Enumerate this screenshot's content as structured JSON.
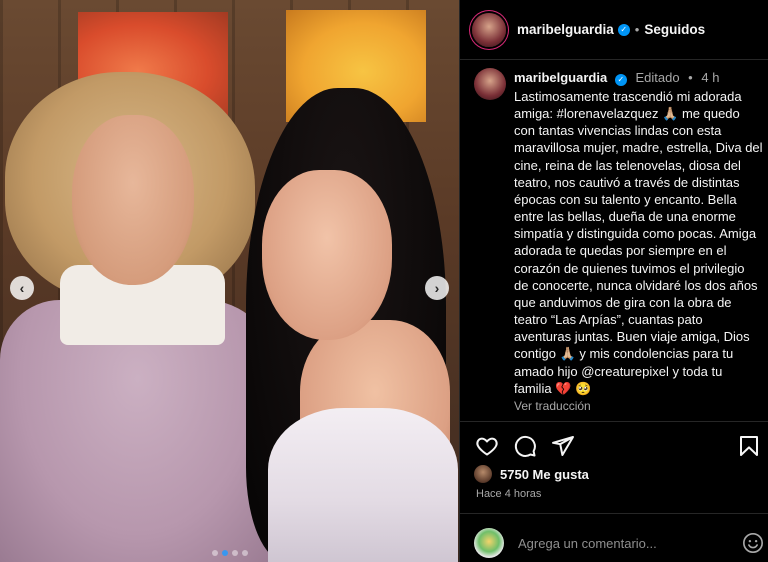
{
  "post": {
    "username": "maribelguardia",
    "following_label": "Seguidos",
    "separator": "•",
    "caption": {
      "edited_label": "Editado",
      "time_ago": "4 h",
      "text": "Lastimosamente trascendió mi adorada\namiga: #lorenavelazquez 🙏🏼 me quedo\ncon tantas vivencias lindas con esta\nmaravillosa mujer, madre, estrella, Diva del\ncine, reina de las telenovelas, diosa del\nteatro, nos cautivó a través de distintas\népocas con su talento y encanto. Bella\nentre las bellas, dueña de una enorme\nsimpatía y distinguida como pocas. Amiga\nadorada te quedas por siempre en el\ncorazón de quienes tuvimos el privilegio\nde conocerte, nunca olvidaré los dos años\nque anduvimos de gira con la obra de\nteatro “Las Arpías”, cuantas pato\naventuras juntas. Buen viaje amiga, Dios\ncontigo 🙏🏼 y mis condolencias para tu\namado hijo @creaturepixel y toda tu\nfamilia 💔 🥺",
      "translate_label": "Ver traducción"
    },
    "likes": {
      "count": "5750",
      "label": "Me gusta"
    },
    "timestamp": "Hace 4 horas",
    "comment": {
      "placeholder": "Agrega un comentario..."
    },
    "carousel": {
      "prev": "‹",
      "next": "›",
      "total_slides": 4,
      "active_slide": 2
    }
  },
  "icons": {
    "heart": "heart-icon",
    "comment": "comment-icon",
    "share": "share-icon",
    "bookmark": "bookmark-icon",
    "emoji": "emoji-icon",
    "verified": "verified-badge-icon"
  },
  "colors": {
    "background": "#000000",
    "text": "#f5f5f5",
    "muted": "#a8a8a8",
    "verified": "#0095f6",
    "broken_heart": "#e0245e"
  }
}
